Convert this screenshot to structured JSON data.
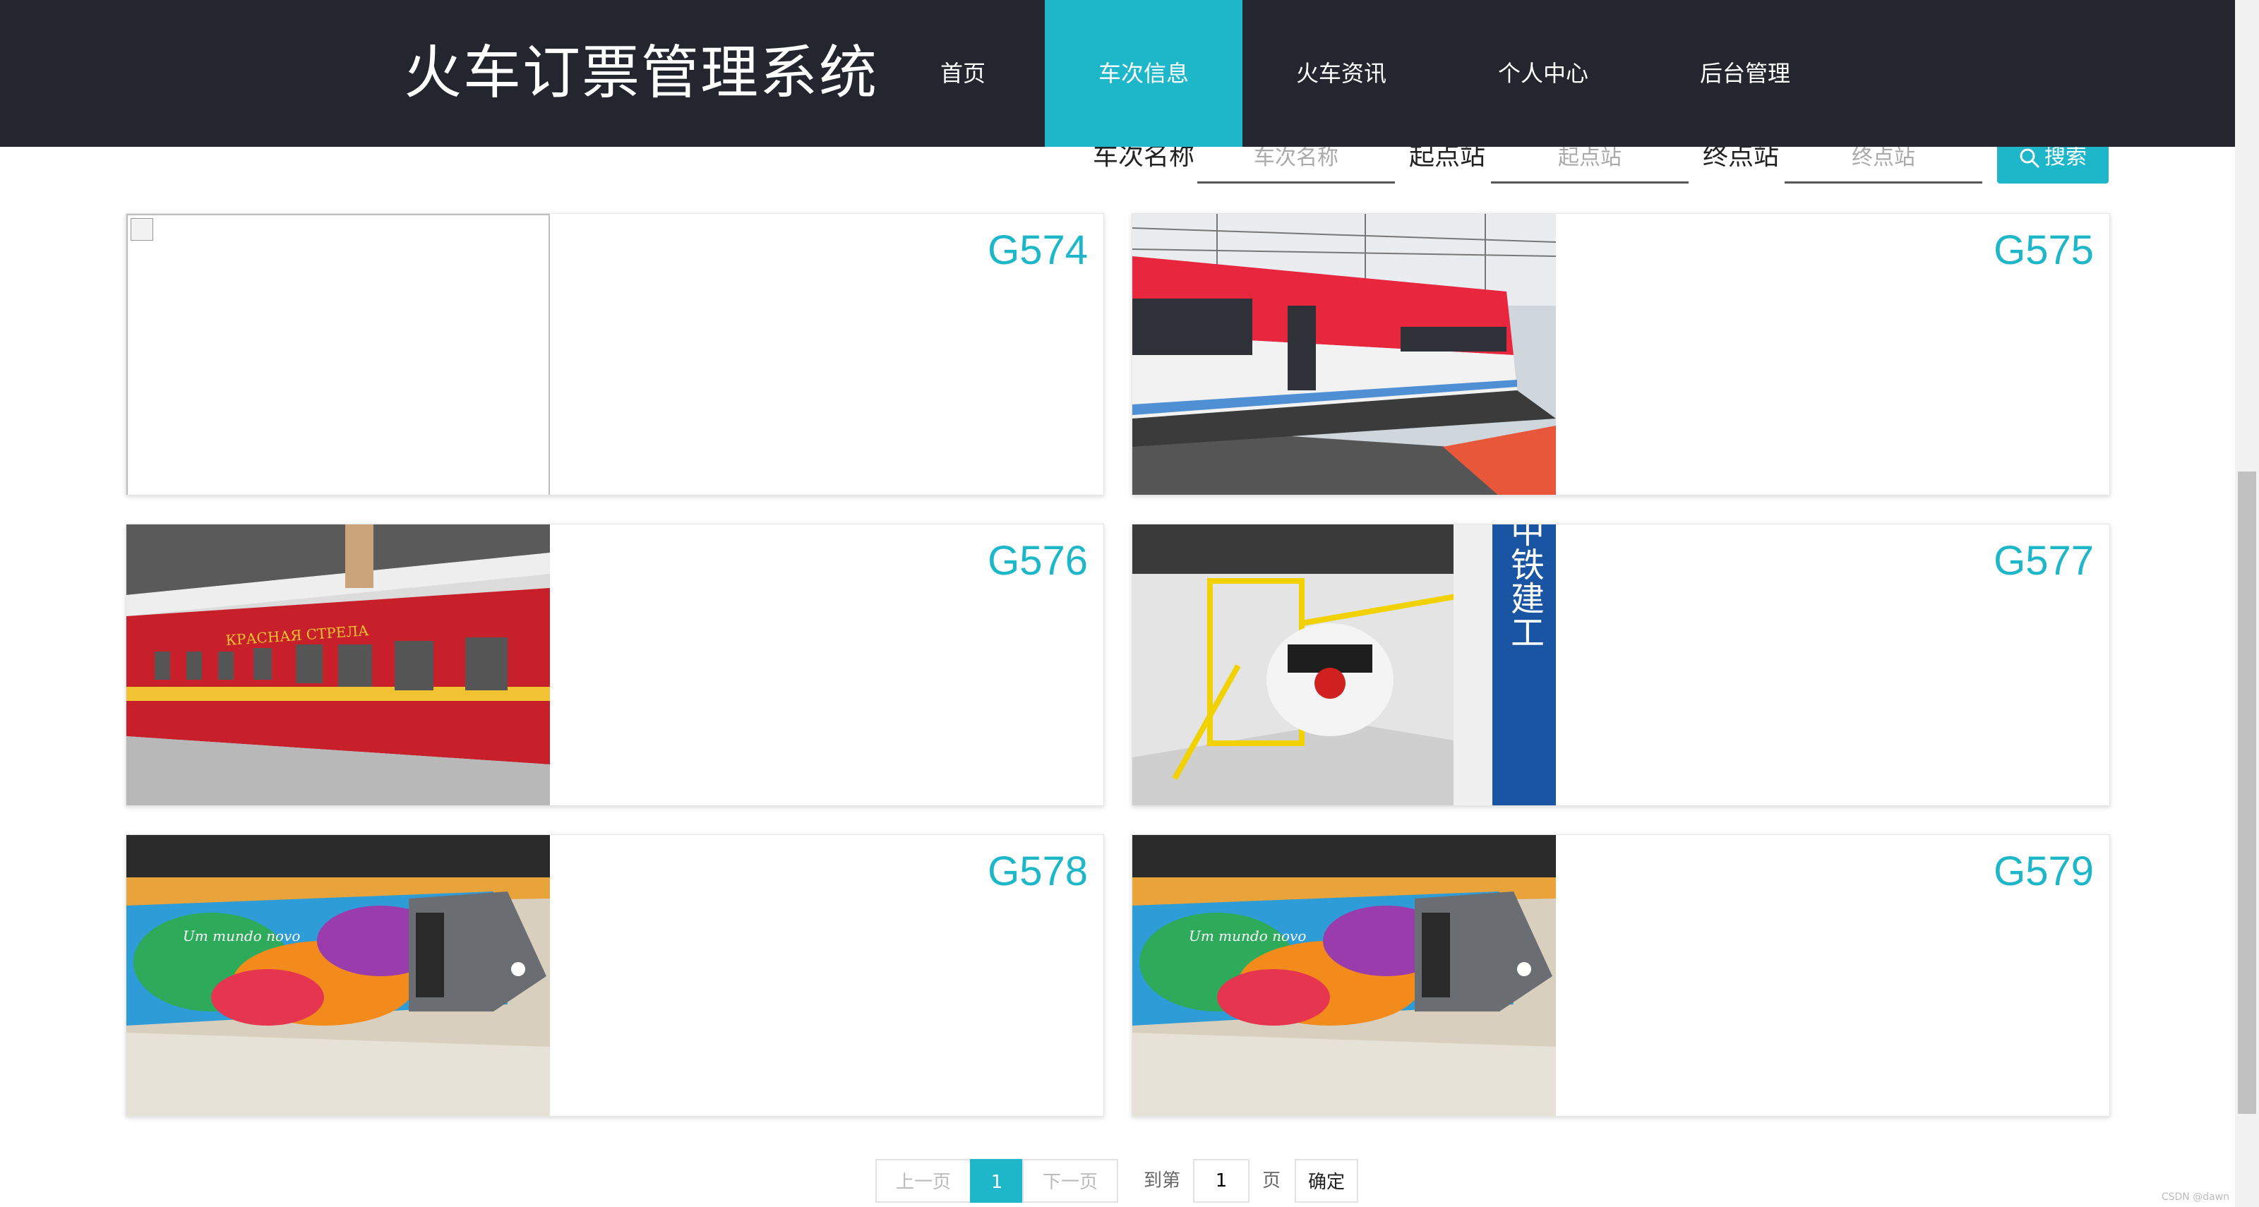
{
  "nav": {
    "brand": "火车订票管理系统",
    "items": [
      {
        "label": "首页"
      },
      {
        "label": "车次信息"
      },
      {
        "label": "火车资讯"
      },
      {
        "label": "个人中心"
      },
      {
        "label": "后台管理"
      }
    ],
    "active_index": 1
  },
  "search": {
    "train_name_label": "车次名称",
    "train_name_placeholder": "车次名称",
    "start_label": "起点站",
    "start_placeholder": "起点站",
    "end_label": "终点站",
    "end_placeholder": "终点站",
    "button_label": "搜索"
  },
  "trains": [
    {
      "code": "G574",
      "image": "broken-image"
    },
    {
      "code": "G575",
      "image": "red-white-train"
    },
    {
      "code": "G576",
      "image": "red-sleeper-car"
    },
    {
      "code": "G577",
      "image": "metro-depot"
    },
    {
      "code": "G578",
      "image": "colorful-metro"
    },
    {
      "code": "G579",
      "image": "colorful-metro"
    }
  ],
  "image_text": {
    "cyrillic": "КРАСНАЯ СТРЕЛА",
    "sign_chars": "中铁建工",
    "metro_slogan": "Um mundo novo"
  },
  "pagination": {
    "prev_label": "上一页",
    "current_page": "1",
    "next_label": "下一页",
    "goto_label": "到第",
    "goto_value": "1",
    "page_unit": "页",
    "confirm_label": "确定"
  },
  "watermark": "CSDN @dawn",
  "colors": {
    "accent": "#1db7c9",
    "nav_bg": "#23262e"
  }
}
